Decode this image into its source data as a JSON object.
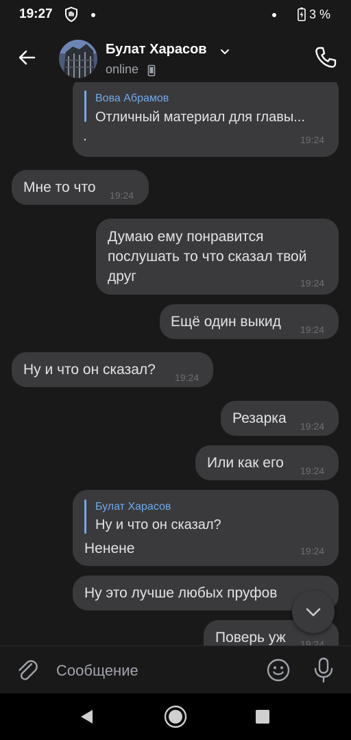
{
  "status_bar": {
    "time": "19:27",
    "battery": "3 %"
  },
  "header": {
    "contact_name": "Булат Харасов",
    "contact_status": "online"
  },
  "messages": [
    {
      "side": "out",
      "reply_author": "Вова Абрамов",
      "reply_text": "Отличный материал для главы...",
      "text": ".",
      "time": "19:24"
    },
    {
      "side": "in",
      "text": "Мне то что",
      "time": "19:24"
    },
    {
      "side": "out",
      "text": "Думаю ему понравится послушать то что сказал твой друг",
      "time": "19:24"
    },
    {
      "side": "out",
      "text": "Ещё один выкид",
      "time": "19:24"
    },
    {
      "side": "in",
      "text": "Ну и что он сказал?",
      "time": "19:24"
    },
    {
      "side": "out",
      "text": "Резарка",
      "time": "19:24"
    },
    {
      "side": "out",
      "text": "Или как его",
      "time": "19:24"
    },
    {
      "side": "out",
      "reply_author": "Булат Харасов",
      "reply_text": "Ну и что он сказал?",
      "text": "Ненене",
      "time": "19:24"
    },
    {
      "side": "out",
      "text": "Ну это лучше любых пруфов",
      "time": ""
    },
    {
      "side": "out",
      "text": "Поверь уж",
      "time": "19:24"
    }
  ],
  "composer": {
    "placeholder": "Сообщение"
  },
  "colors": {
    "background": "#19191a",
    "bubble": "#3a3a3c",
    "accent": "#71aaeb"
  },
  "icons": {
    "back": "arrow-left-icon",
    "phone": "phone-icon",
    "attach": "paperclip-icon",
    "emoji": "smile-icon",
    "mic": "microphone-icon",
    "scroll": "chevron-down-icon"
  }
}
